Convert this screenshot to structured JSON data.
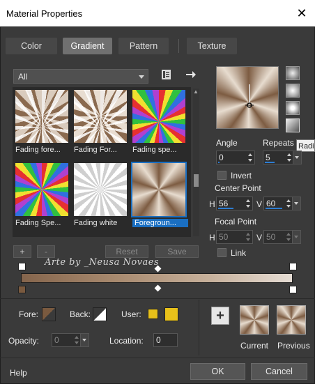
{
  "window": {
    "title": "Material Properties",
    "close_glyph": "✕"
  },
  "tabs": [
    {
      "label": "Color"
    },
    {
      "label": "Gradient",
      "active": true
    },
    {
      "label": "Pattern"
    },
    {
      "label": "Texture"
    }
  ],
  "gallery": {
    "filter_value": "All",
    "items": [
      {
        "label": "Fading fore..."
      },
      {
        "label": "Fading For..."
      },
      {
        "label": "Fading spe..."
      },
      {
        "label": "Fading Spe..."
      },
      {
        "label": "Fading white"
      },
      {
        "label": "Foregroun...",
        "selected": true
      }
    ],
    "buttons": {
      "add": "+",
      "remove": "-",
      "reset": "Reset",
      "save": "Save"
    }
  },
  "style": {
    "tooltip": "Radi"
  },
  "settings": {
    "angle_label": "Angle",
    "angle_value": "0",
    "repeats_label": "Repeats",
    "repeats_value": "5",
    "invert_label": "Invert",
    "center_label": "Center Point",
    "center_h_label": "H",
    "center_h": "56",
    "center_v_label": "V",
    "center_v": "60",
    "focal_label": "Focal Point",
    "focal_h_label": "H",
    "focal_h": "50",
    "focal_v_label": "V",
    "focal_v": "50",
    "link_label": "Link"
  },
  "editor": {
    "watermark": "Arte by _Neusa Novaes"
  },
  "bottom": {
    "fore_label": "Fore:",
    "back_label": "Back:",
    "user_label": "User:",
    "opacity_label": "Opacity:",
    "opacity_value": "0",
    "location_label": "Location:",
    "location_value": "0",
    "current_label": "Current",
    "previous_label": "Previous",
    "add_glyph": "+"
  },
  "footer": {
    "help": "Help",
    "ok": "OK",
    "cancel": "Cancel"
  },
  "colors": {
    "accent": "#1a6fc2",
    "gold": "#e8c11a",
    "brown": "#7a5a3f",
    "bg": "#3b3b3b"
  }
}
